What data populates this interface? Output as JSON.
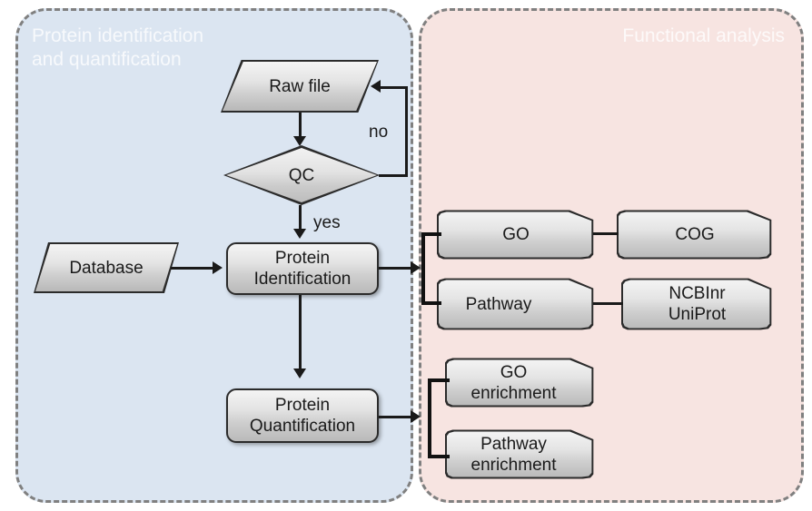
{
  "panels": {
    "left": {
      "title": "Protein identification\nand quantification",
      "bg_color": "#dbe5f1",
      "border_color": "#808080"
    },
    "right": {
      "title": "Functional analysis",
      "bg_color": "#f7e4e1",
      "border_color": "#808080"
    }
  },
  "nodes": {
    "raw_file": {
      "label": "Raw file",
      "shape": "parallelogram"
    },
    "qc": {
      "label": "QC",
      "shape": "diamond"
    },
    "database": {
      "label": "Database",
      "shape": "parallelogram"
    },
    "protein_identification": {
      "label": "Protein\nIdentification",
      "shape": "rounded-rect"
    },
    "protein_quantification": {
      "label": "Protein\nQuantification",
      "shape": "rounded-rect"
    },
    "go": {
      "label": "GO",
      "shape": "cut-corner-rect"
    },
    "cog": {
      "label": "COG",
      "shape": "cut-corner-rect"
    },
    "pathway": {
      "label": "Pathway",
      "shape": "cut-corner-rect"
    },
    "ncbinr_uniprot": {
      "label": "NCBInr\nUniProt",
      "shape": "cut-corner-rect"
    },
    "go_enrichment": {
      "label": "GO\nenrichment",
      "shape": "cut-corner-rect"
    },
    "pathway_enrichment": {
      "label": "Pathway\nenrichment",
      "shape": "cut-corner-rect"
    }
  },
  "edge_labels": {
    "no": "no",
    "yes": "yes"
  },
  "colors": {
    "node_border": "#2b2b2b",
    "node_fill_top": "#f4f4f4",
    "node_fill_bottom": "#b9b9b9",
    "connector": "#1a1a1a",
    "title_text": "#ffffff"
  }
}
